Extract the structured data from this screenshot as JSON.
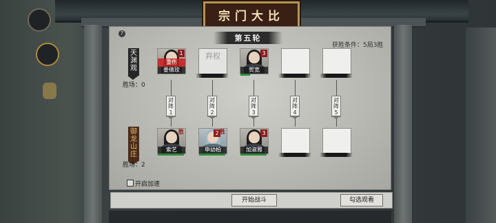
{
  "header": {
    "title": "宗门大比"
  },
  "round": {
    "label": "第五轮"
  },
  "win_condition": "获胜条件：5局3胜",
  "help": "?",
  "team_top": {
    "sect": "天渊观",
    "wins_label": "胜场：0",
    "slots": [
      {
        "name": "姜倩玫",
        "badge": "1",
        "status": "重伤"
      },
      {
        "name": "",
        "status": "弃权"
      },
      {
        "name": "贺宽",
        "badge": "3"
      },
      {
        "name": ""
      },
      {
        "name": ""
      }
    ]
  },
  "team_bottom": {
    "sect": "御龙山庄",
    "wins_label": "胜场：2",
    "slots": [
      {
        "name": "索艺",
        "badge": "1",
        "result": "胜"
      },
      {
        "name": "申幼柏",
        "badge": "2",
        "result": "胜"
      },
      {
        "name": "加淑雅",
        "badge": "3"
      },
      {
        "name": ""
      },
      {
        "name": ""
      }
    ]
  },
  "matches": [
    "对阵1",
    "对阵2",
    "对阵3",
    "对阵4",
    "对阵5"
  ],
  "auto_speed_label": "开启加速",
  "buttons": {
    "start": "开始战斗",
    "watch": "勾选观看"
  },
  "colors": {
    "sign_bg": "#3a1f14",
    "sign_border": "#b4954f",
    "badge": "#8e1b1b",
    "injured": "#c81e1e",
    "hp": "#2d8a3a"
  }
}
